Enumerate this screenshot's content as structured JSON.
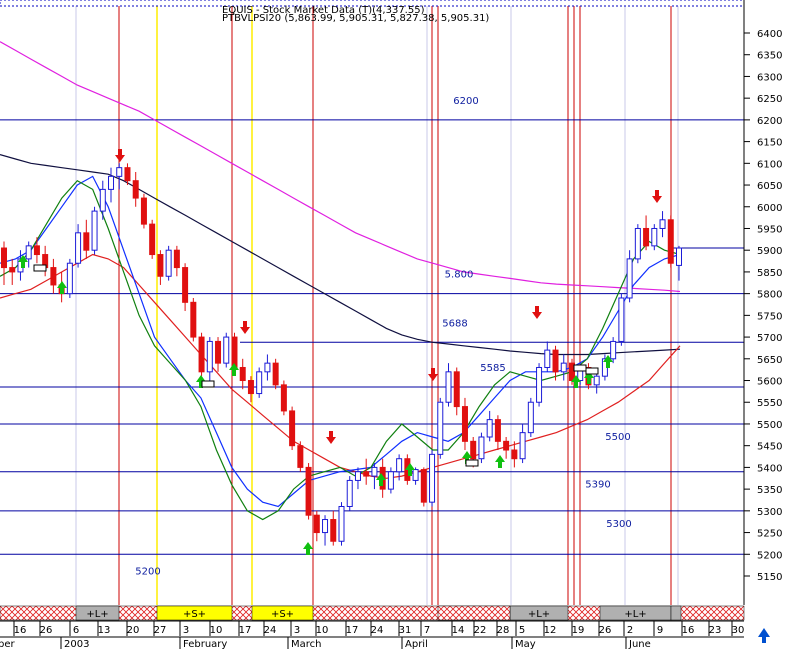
{
  "header": {
    "line1": "EQUIS - Stock Market Data (T)(4,337.55)",
    "line2": "PTBVLPSI20 (5,863.99, 5,905.31, 5,827.38, 5,905.31)"
  },
  "chart_data": {
    "type": "candlestick",
    "y_ticks": [
      5150,
      5200,
      5250,
      5300,
      5350,
      5400,
      5450,
      5500,
      5550,
      5600,
      5650,
      5700,
      5750,
      5800,
      5850,
      5900,
      5950,
      6000,
      6050,
      6100,
      6150,
      6200,
      6250,
      6300,
      6350,
      6400
    ],
    "ylim": [
      5100,
      6450
    ],
    "x_tick_labels": [
      "16",
      "26",
      "6",
      "13",
      "20",
      "27",
      "3",
      "10",
      "17",
      "24",
      "3",
      "10",
      "17",
      "24",
      "31",
      "7",
      "14",
      "22",
      "28",
      "5",
      "12",
      "19",
      "26",
      "2",
      "9",
      "16",
      "23",
      "30"
    ],
    "month_labels": [
      "2003",
      "February",
      "March",
      "April",
      "May",
      "June"
    ],
    "left_edge_label": "ber",
    "last_price_line": 5905,
    "horizontal_levels": [
      {
        "value": 6200,
        "label": "6200"
      },
      {
        "value": 5800,
        "label": "5.800"
      },
      {
        "value": 5688,
        "label": "5688"
      },
      {
        "value": 5585,
        "label": "5585"
      },
      {
        "value": 5500,
        "label": "5500"
      },
      {
        "value": 5390,
        "label": "5390"
      },
      {
        "value": 5300,
        "label": "5300"
      },
      {
        "value": 5200,
        "label": "5200"
      }
    ],
    "signal_bands": [
      {
        "label": "+L+",
        "type": "long"
      },
      {
        "label": "+S+",
        "type": "short"
      },
      {
        "label": "+S+",
        "type": "short"
      },
      {
        "label": "+L+",
        "type": "long"
      },
      {
        "label": "+L+",
        "type": "long"
      }
    ],
    "candles": [
      [
        5905,
        5920,
        5820,
        5860
      ],
      [
        5860,
        5880,
        5820,
        5850
      ],
      [
        5850,
        5900,
        5830,
        5880
      ],
      [
        5880,
        5920,
        5860,
        5910
      ],
      [
        5910,
        5930,
        5870,
        5890
      ],
      [
        5890,
        5910,
        5840,
        5860
      ],
      [
        5860,
        5880,
        5800,
        5820
      ],
      [
        5820,
        5850,
        5780,
        5800
      ],
      [
        5800,
        5880,
        5790,
        5870
      ],
      [
        5870,
        5960,
        5860,
        5940
      ],
      [
        5940,
        5970,
        5880,
        5900
      ],
      [
        5900,
        6000,
        5890,
        5990
      ],
      [
        5990,
        6060,
        5970,
        6040
      ],
      [
        6040,
        6090,
        6010,
        6070
      ],
      [
        6070,
        6100,
        6040,
        6090
      ],
      [
        6090,
        6100,
        6050,
        6060
      ],
      [
        6060,
        6080,
        6000,
        6020
      ],
      [
        6020,
        6030,
        5950,
        5960
      ],
      [
        5960,
        5970,
        5880,
        5890
      ],
      [
        5890,
        5900,
        5820,
        5840
      ],
      [
        5840,
        5910,
        5830,
        5900
      ],
      [
        5900,
        5910,
        5840,
        5860
      ],
      [
        5860,
        5870,
        5760,
        5780
      ],
      [
        5780,
        5790,
        5690,
        5700
      ],
      [
        5700,
        5710,
        5610,
        5620
      ],
      [
        5620,
        5700,
        5600,
        5690
      ],
      [
        5690,
        5700,
        5620,
        5640
      ],
      [
        5640,
        5710,
        5630,
        5700
      ],
      [
        5700,
        5710,
        5620,
        5630
      ],
      [
        5630,
        5650,
        5580,
        5600
      ],
      [
        5600,
        5610,
        5550,
        5570
      ],
      [
        5570,
        5630,
        5560,
        5620
      ],
      [
        5620,
        5660,
        5600,
        5640
      ],
      [
        5640,
        5650,
        5580,
        5590
      ],
      [
        5590,
        5600,
        5520,
        5530
      ],
      [
        5530,
        5540,
        5440,
        5450
      ],
      [
        5450,
        5460,
        5390,
        5400
      ],
      [
        5400,
        5410,
        5280,
        5290
      ],
      [
        5290,
        5300,
        5230,
        5250
      ],
      [
        5250,
        5290,
        5220,
        5280
      ],
      [
        5280,
        5300,
        5220,
        5230
      ],
      [
        5230,
        5320,
        5220,
        5310
      ],
      [
        5310,
        5380,
        5300,
        5370
      ],
      [
        5370,
        5400,
        5350,
        5390
      ],
      [
        5390,
        5420,
        5360,
        5380
      ],
      [
        5380,
        5410,
        5350,
        5400
      ],
      [
        5400,
        5420,
        5330,
        5350
      ],
      [
        5350,
        5400,
        5340,
        5390
      ],
      [
        5390,
        5430,
        5370,
        5420
      ],
      [
        5420,
        5430,
        5360,
        5370
      ],
      [
        5370,
        5400,
        5360,
        5395
      ],
      [
        5395,
        5400,
        5310,
        5320
      ],
      [
        5320,
        5440,
        5310,
        5430
      ],
      [
        5430,
        5560,
        5420,
        5550
      ],
      [
        5550,
        5640,
        5540,
        5620
      ],
      [
        5620,
        5630,
        5520,
        5540
      ],
      [
        5540,
        5560,
        5440,
        5460
      ],
      [
        5460,
        5470,
        5400,
        5420
      ],
      [
        5420,
        5480,
        5410,
        5470
      ],
      [
        5470,
        5530,
        5460,
        5510
      ],
      [
        5510,
        5520,
        5440,
        5460
      ],
      [
        5460,
        5470,
        5420,
        5440
      ],
      [
        5440,
        5460,
        5400,
        5420
      ],
      [
        5420,
        5500,
        5410,
        5480
      ],
      [
        5480,
        5560,
        5470,
        5550
      ],
      [
        5550,
        5640,
        5540,
        5630
      ],
      [
        5630,
        5690,
        5620,
        5670
      ],
      [
        5670,
        5680,
        5600,
        5620
      ],
      [
        5620,
        5660,
        5600,
        5640
      ],
      [
        5640,
        5650,
        5590,
        5600
      ],
      [
        5600,
        5640,
        5590,
        5630
      ],
      [
        5630,
        5640,
        5580,
        5590
      ],
      [
        5590,
        5620,
        5570,
        5610
      ],
      [
        5610,
        5660,
        5600,
        5650
      ],
      [
        5650,
        5700,
        5640,
        5690
      ],
      [
        5690,
        5800,
        5680,
        5790
      ],
      [
        5790,
        5900,
        5780,
        5880
      ],
      [
        5880,
        5960,
        5870,
        5950
      ],
      [
        5950,
        5980,
        5900,
        5910
      ],
      [
        5910,
        5960,
        5900,
        5950
      ],
      [
        5950,
        5990,
        5930,
        5970
      ],
      [
        5970,
        5980,
        5860,
        5870
      ],
      [
        5865,
        5910,
        5830,
        5905
      ]
    ],
    "series": [
      {
        "values": [
          6380,
          6360,
          6340,
          6320,
          6300,
          6280,
          6265,
          6250,
          6235,
          6220,
          6200,
          6180,
          6160,
          6140,
          6120,
          6100,
          6080,
          6060,
          6040,
          6020,
          6000,
          5980,
          5960,
          5940,
          5925,
          5910,
          5895,
          5880,
          5870,
          5860,
          5850,
          5845,
          5840,
          5835,
          5830,
          5825,
          5822,
          5820,
          5818,
          5816,
          5814,
          5812,
          5810,
          5808,
          5805
        ]
      },
      {
        "values": [
          6120,
          6110,
          6100,
          6095,
          6090,
          6085,
          6080,
          6075,
          6060,
          6040,
          6020,
          6000,
          5980,
          5960,
          5940,
          5920,
          5900,
          5880,
          5860,
          5840,
          5820,
          5800,
          5780,
          5760,
          5740,
          5720,
          5705,
          5695,
          5688,
          5684,
          5680,
          5676,
          5672,
          5668,
          5665,
          5662,
          5660,
          5660,
          5660,
          5662,
          5664,
          5666,
          5668,
          5670,
          5672
        ]
      },
      {
        "values": [
          5790,
          5800,
          5810,
          5830,
          5850,
          5870,
          5890,
          5880,
          5860,
          5820,
          5780,
          5740,
          5700,
          5660,
          5620,
          5580,
          5550,
          5520,
          5490,
          5460,
          5440,
          5420,
          5400,
          5390,
          5380,
          5375,
          5380,
          5390,
          5400,
          5410,
          5420,
          5430,
          5440,
          5450,
          5460,
          5470,
          5480,
          5495,
          5510,
          5530,
          5550,
          5575,
          5600,
          5640,
          5680
        ]
      },
      {
        "values": [
          5870,
          5880,
          5900,
          5950,
          6000,
          6050,
          6070,
          6000,
          5900,
          5800,
          5700,
          5650,
          5600,
          5560,
          5480,
          5400,
          5350,
          5320,
          5310,
          5340,
          5370,
          5380,
          5390,
          5395,
          5400,
          5430,
          5460,
          5480,
          5470,
          5460,
          5480,
          5520,
          5560,
          5600,
          5620,
          5620,
          5620,
          5630,
          5650,
          5700,
          5760,
          5820,
          5860,
          5880,
          5890
        ]
      },
      {
        "values": [
          5840,
          5860,
          5900,
          5960,
          6020,
          6060,
          6040,
          5950,
          5850,
          5750,
          5680,
          5640,
          5600,
          5540,
          5440,
          5360,
          5300,
          5280,
          5300,
          5350,
          5380,
          5390,
          5400,
          5380,
          5400,
          5460,
          5500,
          5470,
          5440,
          5440,
          5480,
          5540,
          5590,
          5620,
          5610,
          5600,
          5610,
          5620,
          5650,
          5720,
          5800,
          5880,
          5920,
          5900,
          5890
        ]
      }
    ]
  },
  "colors": {
    "bull": "#1c1cd8",
    "bear": "#e01010",
    "grid": "#0000a0",
    "ma_long": "#e020e0",
    "ma_mid": "#101040",
    "ma_slow": "#e02020",
    "ma_fast": "#1030ff",
    "ma_fastest": "#108010",
    "vline_red": "#cc0000",
    "vline_yellow": "#ffee00",
    "band_long": "#b0b0b0",
    "band_short": "#ffff00",
    "up_arrow": "#10c010",
    "down_arrow": "#e01010",
    "corner_arrow": "#0050d0"
  }
}
